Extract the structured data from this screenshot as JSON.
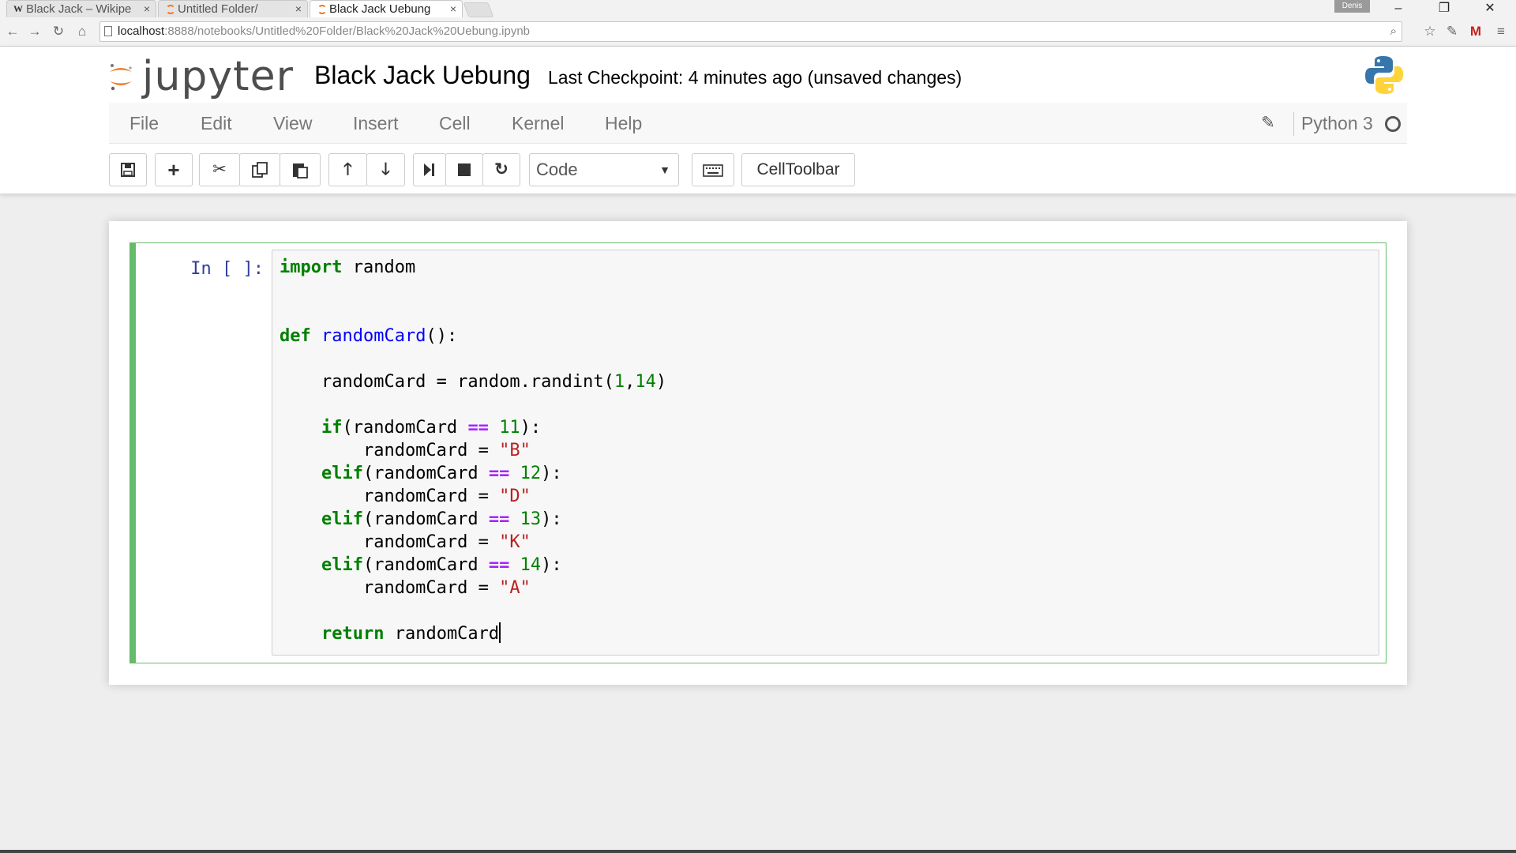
{
  "browser": {
    "tabs": [
      {
        "title": "Black Jack – Wikipe",
        "favicon": "wikipedia-icon",
        "active": false
      },
      {
        "title": "Untitled Folder/",
        "favicon": "jupyter-icon",
        "active": false
      },
      {
        "title": "Black Jack Uebung",
        "favicon": "jupyter-icon",
        "active": true
      }
    ],
    "tab_close_glyph": "×",
    "user_name": "Denis",
    "url_host": "localhost",
    "url_path": ":8888/notebooks/Untitled%20Folder/Black%20Jack%20Uebung.ipynb",
    "nav_icons": [
      "back-icon",
      "forward-icon",
      "reload-icon",
      "home-icon"
    ],
    "extension_icons": [
      "zoom-icon",
      "star-icon",
      "pen-extension-icon",
      "gmail-icon",
      "chrome-menu-icon"
    ]
  },
  "jupyter": {
    "logo_text": "jupyter",
    "notebook_name": "Black Jack Uebung",
    "checkpoint": "Last Checkpoint: 4 minutes ago (unsaved changes)",
    "menu": [
      "File",
      "Edit",
      "View",
      "Insert",
      "Cell",
      "Kernel",
      "Help"
    ],
    "kernel": "Python 3",
    "cell_type": "Code",
    "celltoolbar_label": "CellToolbar",
    "toolbar_icons": [
      "save-icon",
      "add-cell-icon",
      "cut-icon",
      "copy-icon",
      "paste-icon",
      "move-up-icon",
      "move-down-icon",
      "run-icon",
      "stop-icon",
      "restart-icon",
      "keyboard-icon"
    ],
    "accent_color": "#66bb6a",
    "logo_color": "#f37726"
  },
  "cell": {
    "prompt": "In [ ]:",
    "code_lines": [
      "import random",
      "",
      "",
      "def randomCard():",
      "",
      "    randomCard = random.randint(1,14)",
      "",
      "    if(randomCard == 11):",
      "        randomCard = \"B\"",
      "    elif(randomCard == 12):",
      "        randomCard = \"D\"",
      "    elif(randomCard == 13):",
      "        randomCard = \"K\"",
      "    elif(randomCard == 14):",
      "        randomCard = \"A\"",
      "",
      "    return randomCard"
    ]
  }
}
